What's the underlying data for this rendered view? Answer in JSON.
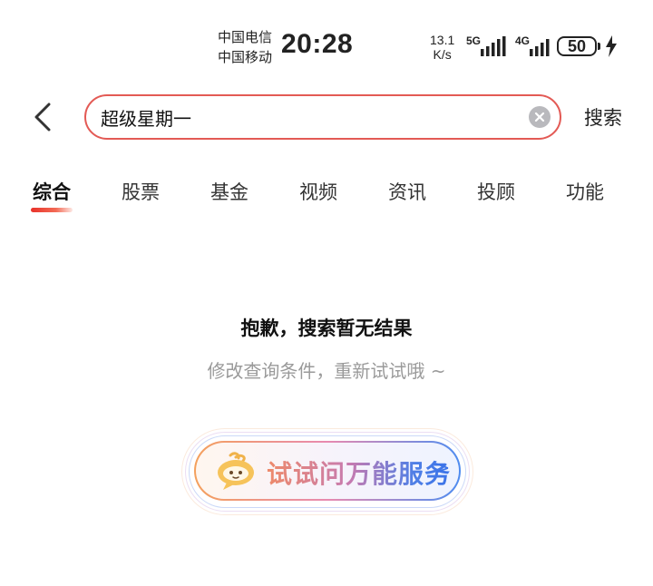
{
  "status_bar": {
    "carrier_1": "中国电信",
    "carrier_2": "中国移动",
    "time": "20:28",
    "net_speed_value": "13.1",
    "net_speed_unit": "K/s",
    "sim1_tag": "5G",
    "sim2_tag": "4G",
    "battery_level": "50"
  },
  "search": {
    "query": "超级星期一",
    "button_label": "搜索"
  },
  "tabs": [
    {
      "label": "综合",
      "active": true
    },
    {
      "label": "股票",
      "active": false
    },
    {
      "label": "基金",
      "active": false
    },
    {
      "label": "视频",
      "active": false
    },
    {
      "label": "资讯",
      "active": false
    },
    {
      "label": "投顾",
      "active": false
    },
    {
      "label": "功能",
      "active": false
    }
  ],
  "empty_state": {
    "title": "抱歉，搜索暂无结果",
    "subtitle": "修改查询条件，重新试试哦 ~"
  },
  "ask_assistant": {
    "label": "试试问万能服务",
    "chevron": ">"
  },
  "colors": {
    "accent_red": "#e35a55",
    "gradient_blue": "#3b73e8",
    "subtle_gray": "#9a9a9a"
  },
  "icons": {
    "back": "chevron-left-icon",
    "clear": "clear-circle-icon",
    "charging": "lightning-icon",
    "mascot": "assistant-mascot-icon"
  }
}
